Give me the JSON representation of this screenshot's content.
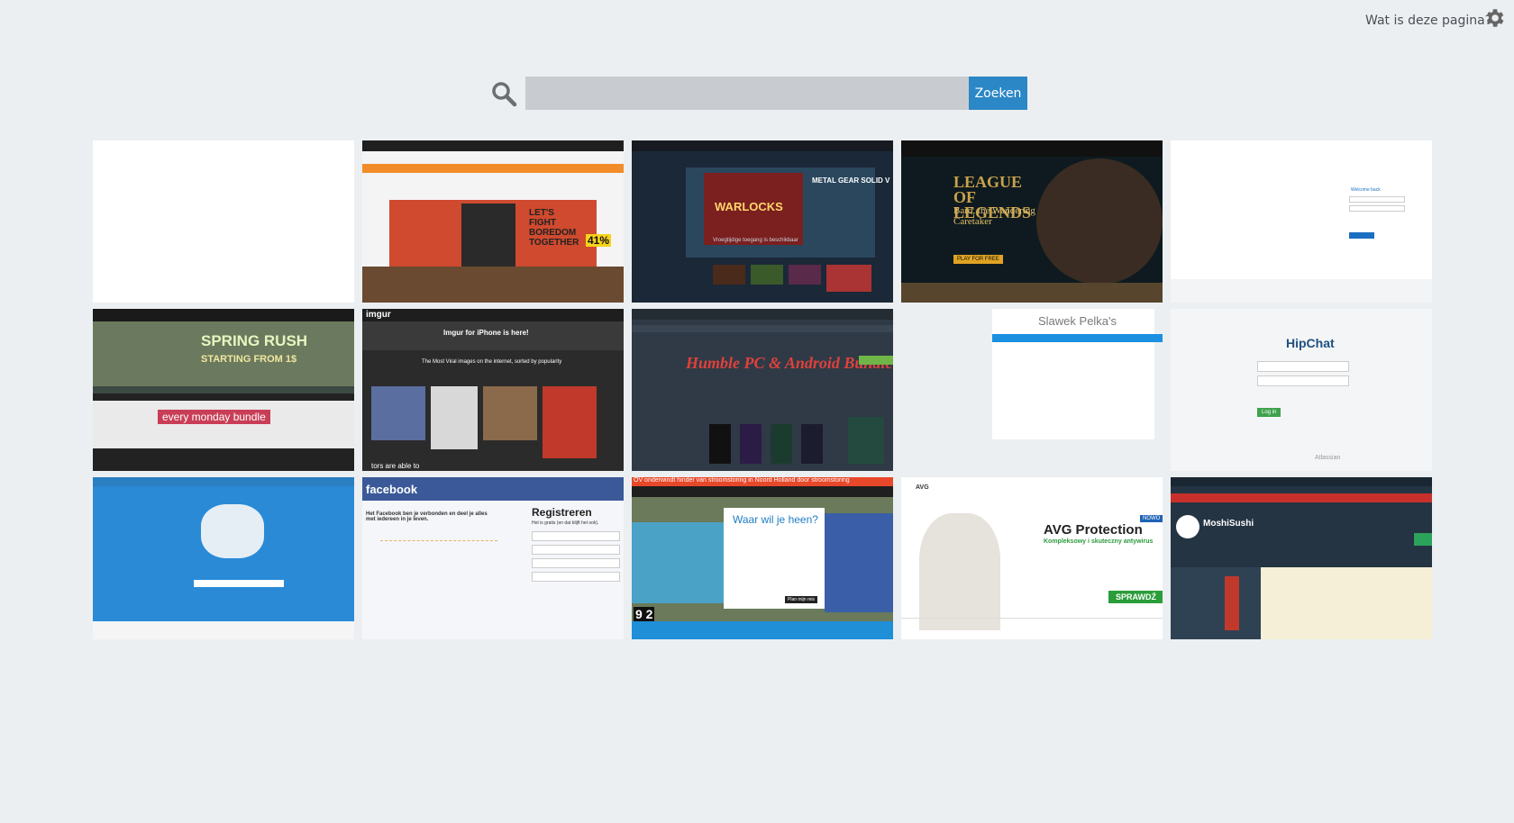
{
  "header": {
    "help_link": "Wat is deze pagina?",
    "settings_icon": "gear-icon"
  },
  "search": {
    "icon": "search-icon",
    "placeholder": "",
    "value": "",
    "button_label": "Zoeken"
  },
  "tiles": {
    "t1": {},
    "t2": {
      "banner": "LET'S FIGHT BOREDOM TOGETHER",
      "badge": "41%"
    },
    "t3": {
      "hero": "WARLOCKS",
      "side": "METAL GEAR SOLID V",
      "caption": "Vroegtijdige toegang is beschikbaar"
    },
    "t4": {
      "logo": "LEAGUE OF LEGENDS",
      "title": "Bard, the Wandering Caretaker",
      "cta": "PLAY FOR FREE"
    },
    "t5": {
      "title": "Welcome back"
    },
    "t6": {
      "title": "SPRING RUSH",
      "subtitle": "STARTING FROM 1$",
      "banner": "every monday bundle"
    },
    "t7": {
      "logo": "imgur",
      "notice": "Imgur for iPhone is here!",
      "tagline": "The Most Viral images on the internet, sorted by popularity",
      "bottom": "tors are able to"
    },
    "t8": {
      "title": "Humble PC & Android Bundle 12"
    },
    "t9": {
      "title": "Slawek Pelka's"
    },
    "t10": {
      "logo": "HipChat",
      "login_button": "Log in",
      "footer": "Atlassian"
    },
    "t11": {},
    "t12": {
      "logo": "facebook",
      "text": "Het Facebook ben je verbonden en deel je alles met iedereen in je leven.",
      "title": "Registreren",
      "subtitle": "Het is gratis (en dat blijft het ook)."
    },
    "t13": {
      "banner": "OV onderwindt hinder van stroomstoring in Noord Holland door stroomstoring",
      "title": "Waar wil je heen?",
      "button": "Plan mijn reis",
      "numbers": "9 2"
    },
    "t14": {
      "logo": "AVG",
      "title": "AVG Protection",
      "subtitle": "Kompleksowy i skuteczny antywirus",
      "badge": "NOWO",
      "cta": "SPRAWDŹ"
    },
    "t15": {
      "name": "MoshiSushi"
    }
  },
  "colors": {
    "background": "#eceff1",
    "search_button": "#2b87c6",
    "search_input": "#c8ccd0"
  }
}
